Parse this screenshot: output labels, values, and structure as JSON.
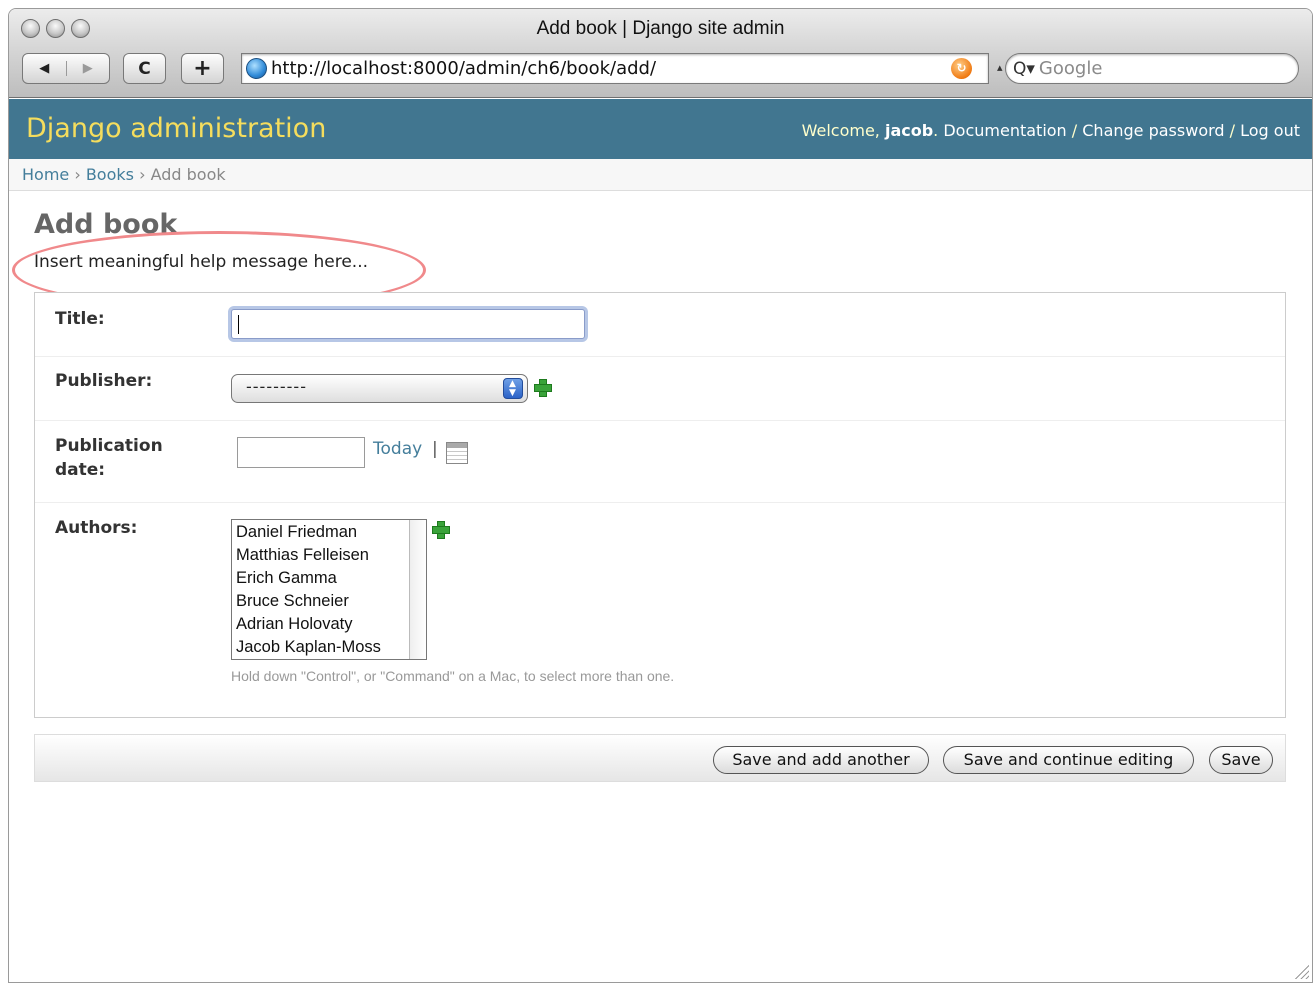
{
  "window": {
    "title": "Add book | Django site admin"
  },
  "toolbar": {
    "back_icon": "◀",
    "forward_icon": "▶",
    "reload_icon": "C",
    "new_tab_icon": "+",
    "url": "http://localhost:8000/admin/ch6/book/add/",
    "search_placeholder": "Google"
  },
  "header": {
    "brand": "Django administration",
    "welcome": "Welcome, ",
    "username": "jacob",
    "period": ". ",
    "documentation": "Documentation",
    "separator": " / ",
    "change_password": "Change password",
    "log_out": "Log out"
  },
  "breadcrumbs": {
    "home": "Home",
    "sep": " › ",
    "books": "Books",
    "current": "Add book"
  },
  "page": {
    "title": "Add book",
    "help": "Insert meaningful help message here...",
    "highlight_color": "#f0898b"
  },
  "form": {
    "title_label": "Title:",
    "title_value": "",
    "publisher_label": "Publisher:",
    "publisher_value": "---------",
    "pubdate_label_line1": "Publication",
    "pubdate_label_line2": "date:",
    "pubdate_value": "",
    "today_link": "Today",
    "today_sep": "|",
    "authors_label": "Authors:",
    "authors": [
      "Daniel Friedman",
      "Matthias Felleisen",
      "Erich Gamma",
      "Bruce Schneier",
      "Adrian Holovaty",
      "Jacob Kaplan-Moss"
    ],
    "authors_help": "Hold down \"Control\", or \"Command\" on a Mac, to select more than one."
  },
  "submit": {
    "save_add_another": "Save and add another",
    "save_continue": "Save and continue editing",
    "save": "Save"
  },
  "colors": {
    "header_bg": "#417690",
    "brand": "#f5dd5d",
    "link": "#447e9b",
    "add_icon": "#3aa33a"
  }
}
